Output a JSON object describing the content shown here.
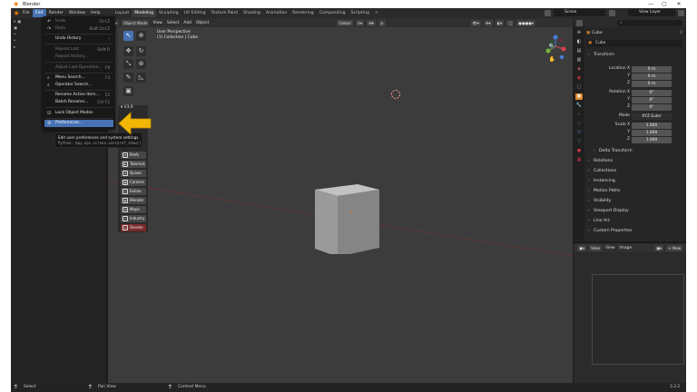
{
  "window": {
    "title": "Blender",
    "controls": [
      "—",
      "▢",
      "✕"
    ]
  },
  "menubar": {
    "items": [
      "File",
      "Edit",
      "Render",
      "Window",
      "Help"
    ],
    "active": "Edit"
  },
  "workspaces": [
    "Layout",
    "Modeling",
    "Sculpting",
    "UV Editing",
    "Texture Paint",
    "Shading",
    "Animation",
    "Rendering",
    "Compositing",
    "Scripting",
    "+"
  ],
  "workspace_active": "Modeling",
  "scene": {
    "label": "Scene",
    "view_layer": "View Layer"
  },
  "viewport": {
    "mode": "Object Mode",
    "menus": [
      "View",
      "Select",
      "Add",
      "Object"
    ],
    "orientation": "Global",
    "info_line1": "User Perspective",
    "info_line2": "(1) Collection | Cube"
  },
  "edit_menu": {
    "items": [
      {
        "label": "Undo",
        "shortcut": "Ctrl Z",
        "dim": true
      },
      {
        "label": "Redo",
        "shortcut": "Shift Ctrl Z",
        "dim": true
      },
      {
        "label": "Undo History",
        "shortcut": "›",
        "dim": false
      },
      {
        "label": "Repeat Last",
        "shortcut": "Shift R",
        "dim": true
      },
      {
        "label": "Repeat History...",
        "shortcut": "",
        "dim": true
      },
      {
        "label": "Adjust Last Operation...",
        "shortcut": "F9",
        "dim": true
      },
      {
        "label": "Menu Search...",
        "shortcut": "F3",
        "dim": false
      },
      {
        "label": "Operator Search...",
        "shortcut": "",
        "dim": false
      },
      {
        "label": "Rename Active Item...",
        "shortcut": "F2",
        "dim": false
      },
      {
        "label": "Batch Rename...",
        "shortcut": "Ctrl F2",
        "dim": false
      },
      {
        "label": "Lock Object Modes",
        "shortcut": "",
        "dim": false
      },
      {
        "label": "Preferences...",
        "shortcut": "",
        "dim": false
      }
    ]
  },
  "tooltip": {
    "text": "Edit user preferences and system settings.",
    "python": "Python: bpy.ops.screen.userpref_show()"
  },
  "addon_panel": {
    "version": "V3.9",
    "buttons": [
      "Prefs",
      "Tutorials",
      "Quixel",
      "Camera",
      "Extras",
      "Blender",
      "Maya",
      "Industry",
      "Donate"
    ]
  },
  "properties": {
    "object_name": "Cube",
    "data_name": "Cube",
    "transform_label": "Transform",
    "location": {
      "label": "Location X",
      "x": "0 m",
      "y": "0 m",
      "z": "0 m"
    },
    "rotation": {
      "label": "Rotation X",
      "x": "0°",
      "y": "0°",
      "z": "0°"
    },
    "mode": {
      "label": "Mode",
      "value": "XYZ Euler"
    },
    "scale": {
      "label": "Scale X",
      "x": "1.000",
      "y": "1.000",
      "z": "1.000"
    },
    "axis_y": "Y",
    "axis_z": "Z",
    "sections": [
      "Delta Transform",
      "Relations",
      "Collections",
      "Instancing",
      "Motion Paths",
      "Visibility",
      "Viewport Display",
      "Line Art",
      "Custom Properties"
    ]
  },
  "image_editor": {
    "view": "View",
    "menus": [
      "View",
      "Image"
    ],
    "new_label": "New"
  },
  "statusbar": {
    "select": "Select",
    "pan": "Pan View",
    "context": "Context Menu",
    "version": "3.2.2"
  },
  "colors": {
    "accent": "#4772b3",
    "arrow": "#f2b705",
    "blender_orange": "#e87d0d"
  }
}
